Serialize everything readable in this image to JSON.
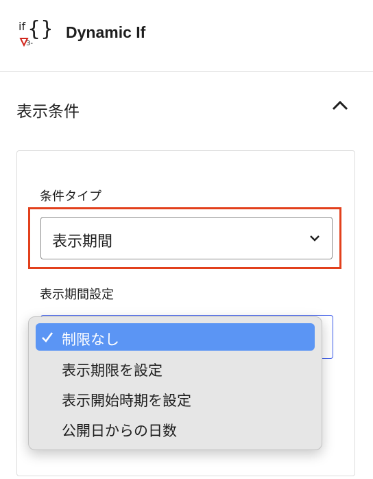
{
  "app": {
    "logo_text": "if{}",
    "title": "Dynamic If"
  },
  "panel": {
    "title": "表示条件",
    "toggle_icon": "chevron-up-icon",
    "expanded": true
  },
  "condition_type": {
    "label": "条件タイプ",
    "selected": "表示期間",
    "highlighted": true
  },
  "period_setting": {
    "label": "表示期間設定",
    "options": [
      {
        "label": "制限なし",
        "selected": true
      },
      {
        "label": "表示期限を設定",
        "selected": false
      },
      {
        "label": "表示開始時期を設定",
        "selected": false
      },
      {
        "label": "公開日からの日数",
        "selected": false
      }
    ]
  },
  "colors": {
    "highlight_border": "#e2401c",
    "selected_option_bg": "#5b95f4",
    "focus_border": "#3858e9",
    "dropdown_bg": "#e6e6e6"
  }
}
